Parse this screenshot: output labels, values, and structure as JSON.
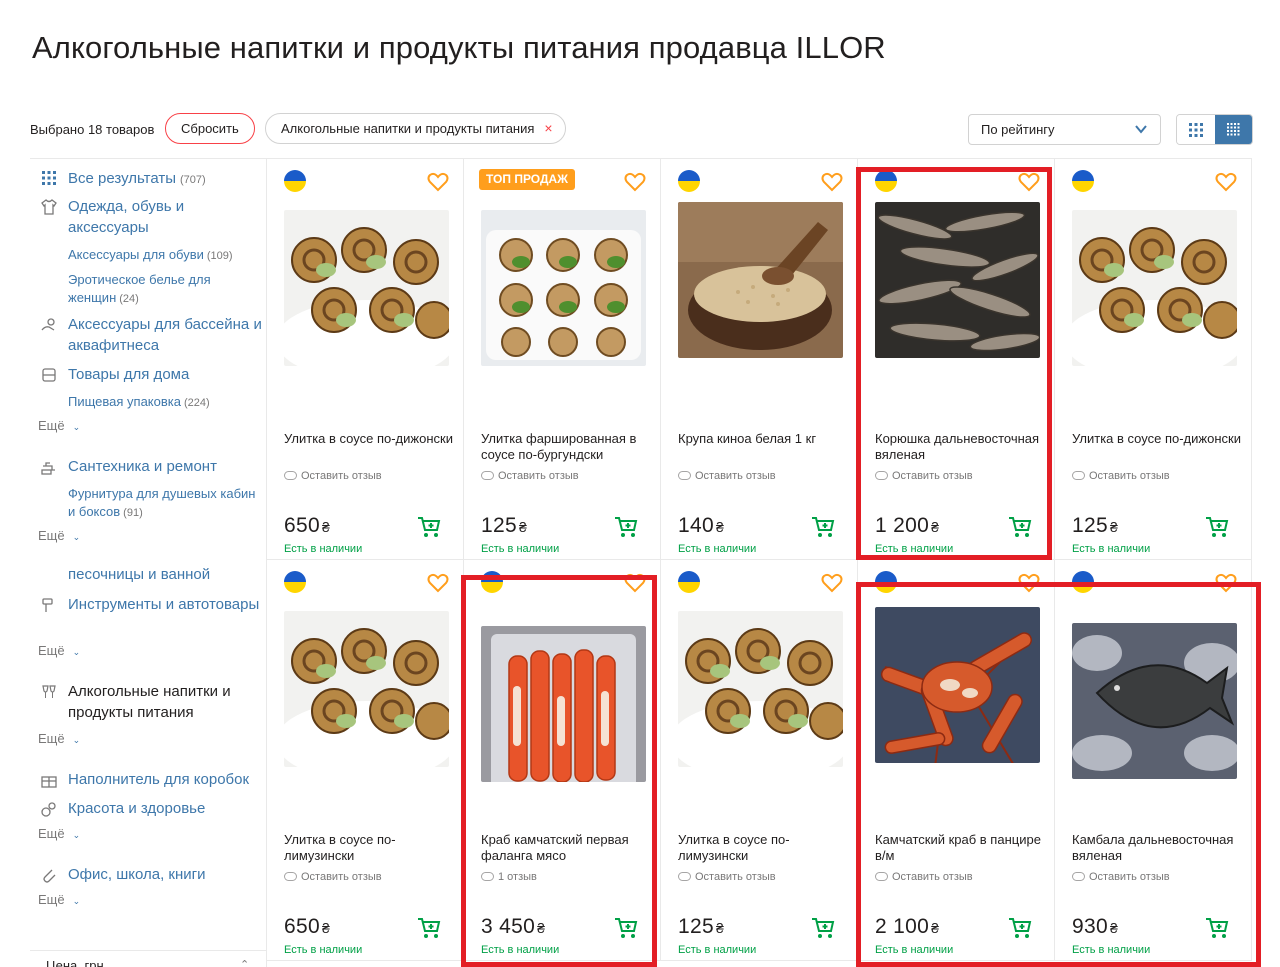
{
  "title": "Алкогольные напитки и продукты питания продавца ILLOR",
  "filters": {
    "selected_count": "Выбрано 18 товаров",
    "reset_label": "Сбросить",
    "chip_label": "Алкогольные напитки и продукты питания",
    "chip_close": "×",
    "sort_label": "По рейтингу"
  },
  "sidebar": {
    "all_results": {
      "label": "Все результаты",
      "count": "(707)"
    },
    "cat1": {
      "label": "Одежда, обувь и аксессуары"
    },
    "sub1": {
      "label": "Аксессуары для обуви",
      "count": "(109)"
    },
    "sub2": {
      "label": "Эротическое белье для женщин",
      "count": "(24)"
    },
    "cat2": {
      "label": "Аксессуары для бассейна и аквафитнеса"
    },
    "cat3": {
      "label": "Товары для дома"
    },
    "sub3": {
      "label": "Пищевая упаковка",
      "count": "(224)"
    },
    "more_label": "Ещё",
    "cat4": {
      "label": "Сантехника и ремонт"
    },
    "sub4": {
      "label": "Фурнитура для душевых кабин и боксов",
      "count": "(91)"
    },
    "sub5": {
      "label": "песочницы и ванной"
    },
    "cat5": {
      "label": "Инструменты и автотовары"
    },
    "cat6": {
      "label": "Алкогольные напитки и продукты питания"
    },
    "cat7": {
      "label": "Наполнитель для коробок"
    },
    "cat8": {
      "label": "Красота и здоровье"
    },
    "cat9": {
      "label": "Офис, школа, книги"
    },
    "price_label": "Цена, грн"
  },
  "currency": "₴",
  "products": [
    {
      "title": "Улитка в соусе по-дижонски",
      "reviews": "Оставить отзыв",
      "price": "650",
      "stock": "Есть в наличии"
    },
    {
      "title": "Улитка фаршированная в соусе по-бургундски",
      "reviews": "Оставить отзыв",
      "price": "125",
      "stock": "Есть в наличии",
      "badge": "ТОП ПРОДАЖ"
    },
    {
      "title": "Крупа киноа белая 1 кг",
      "reviews": "Оставить отзыв",
      "price": "140",
      "stock": "Есть в наличии"
    },
    {
      "title": "Корюшка дальневосточная вяленая",
      "reviews": "Оставить отзыв",
      "price": "1 200",
      "stock": "Есть в наличии"
    },
    {
      "title": "Улитка в соусе по-дижонски",
      "reviews": "Оставить отзыв",
      "price": "125",
      "stock": "Есть в наличии"
    },
    {
      "title": "Улитка в соусе по-лимузински",
      "reviews": "Оставить отзыв",
      "price": "650",
      "stock": "Есть в наличии"
    },
    {
      "title": "Краб камчатский первая фаланга мясо",
      "reviews": "1 отзыв",
      "price": "3 450",
      "stock": "Есть в наличии"
    },
    {
      "title": "Улитка в соусе по-лимузински",
      "reviews": "Оставить отзыв",
      "price": "125",
      "stock": "Есть в наличии"
    },
    {
      "title": "Камчатский краб в панцире в/м",
      "reviews": "Оставить отзыв",
      "price": "2 100",
      "stock": "Есть в наличии"
    },
    {
      "title": "Камбала дальневосточная вяленая",
      "reviews": "Оставить отзыв",
      "price": "930",
      "stock": "Есть в наличии"
    }
  ],
  "colors": {
    "accent": "#3e77aa",
    "stock": "#00a046",
    "highlight": "#e31e25",
    "badge": "#ff9e1c"
  }
}
